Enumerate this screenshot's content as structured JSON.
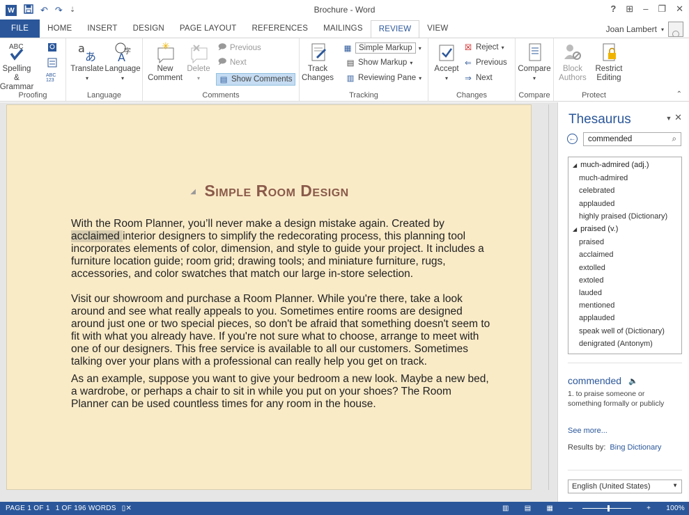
{
  "window": {
    "title": "Brochure - Word",
    "help": "?",
    "restore_ribbon": "⊞",
    "minimize": "–",
    "maximize": "❐",
    "close": "✕"
  },
  "qat": {
    "logo": "W",
    "undo": "↶",
    "redo": "↷",
    "more": "⇣"
  },
  "tabs": [
    "FILE",
    "HOME",
    "INSERT",
    "DESIGN",
    "PAGE LAYOUT",
    "REFERENCES",
    "MAILINGS",
    "REVIEW",
    "VIEW"
  ],
  "active_tab": "REVIEW",
  "user": {
    "name": "Joan Lambert"
  },
  "ribbon": {
    "proofing": {
      "label": "Proofing",
      "spelling": "Spelling &",
      "grammar": "Grammar",
      "abc": "ABC"
    },
    "language": {
      "label": "Language",
      "translate": "Translate",
      "language": "Language"
    },
    "comments": {
      "label": "Comments",
      "new": "New",
      "new2": "Comment",
      "delete": "Delete",
      "previous": "Previous",
      "next": "Next",
      "show": "Show Comments"
    },
    "tracking": {
      "label": "Tracking",
      "track": "Track",
      "track2": "Changes",
      "markup_select": "Simple Markup",
      "show_markup": "Show Markup",
      "reviewing_pane": "Reviewing Pane"
    },
    "changes": {
      "label": "Changes",
      "accept": "Accept",
      "reject": "Reject",
      "previous": "Previous",
      "next": "Next"
    },
    "compare": {
      "label": "Compare",
      "compare": "Compare"
    },
    "protect": {
      "label": "Protect",
      "block": "Block",
      "block2": "Authors",
      "restrict": "Restrict",
      "restrict2": "Editing"
    }
  },
  "document": {
    "title": "Simple Room Design",
    "p1_before": "With the Room Planner, you’ll never make a design mistake again. Created by ",
    "p1_highlight": "acclaimed ",
    "p1_after": "interior designers to simplify the redecorating process, this planning tool incorporates elements of color, dimension, and style to guide your project. It includes a furniture location guide; room grid; drawing tools; and miniature furniture, rugs, accessories, and color swatches that match our large in-store selection.",
    "p2": "Visit our showroom and purchase a Room Planner. While you're there, take a look around and see what really appeals to you. Sometimes entire rooms are designed around just one or two special pieces, so don't be afraid that something doesn't seem to fit with what you already have. If you're not sure what to choose, arrange to meet with one of our designers. This free service is available to all our customers. Sometimes talking over your plans with a professional can really help you get on track.",
    "p3": "As an example, suppose you want to give your bedroom a new look. Maybe a new bed, a wardrobe, or perhaps a chair to sit in while you put on your shoes? The Room Planner can be used countless times for any room in the house."
  },
  "thesaurus": {
    "title": "Thesaurus",
    "search_value": "commended",
    "results": [
      {
        "type": "heading",
        "text": "much-admired (adj.)"
      },
      {
        "type": "word",
        "text": "much-admired"
      },
      {
        "type": "word",
        "text": "celebrated"
      },
      {
        "type": "word",
        "text": "applauded"
      },
      {
        "type": "word",
        "text": "highly praised (Dictionary)"
      },
      {
        "type": "heading",
        "text": "praised (v.)"
      },
      {
        "type": "word",
        "text": "praised"
      },
      {
        "type": "word",
        "text": "acclaimed"
      },
      {
        "type": "word",
        "text": "extolled"
      },
      {
        "type": "word",
        "text": "extoled"
      },
      {
        "type": "word",
        "text": "lauded"
      },
      {
        "type": "word",
        "text": "mentioned"
      },
      {
        "type": "word",
        "text": "applauded"
      },
      {
        "type": "word",
        "text": "speak well of (Dictionary)"
      },
      {
        "type": "word",
        "text": "denigrated (Antonym)"
      }
    ],
    "definition_word": "commended",
    "definition": "1. to praise someone or something formally or publicly",
    "see_more": "See more...",
    "results_by": "Results by:",
    "provider": "Bing Dictionary",
    "language": "English (United States)"
  },
  "status": {
    "page": "PAGE 1 OF 1",
    "words": "1 OF 196 WORDS",
    "zoom": "100%"
  }
}
